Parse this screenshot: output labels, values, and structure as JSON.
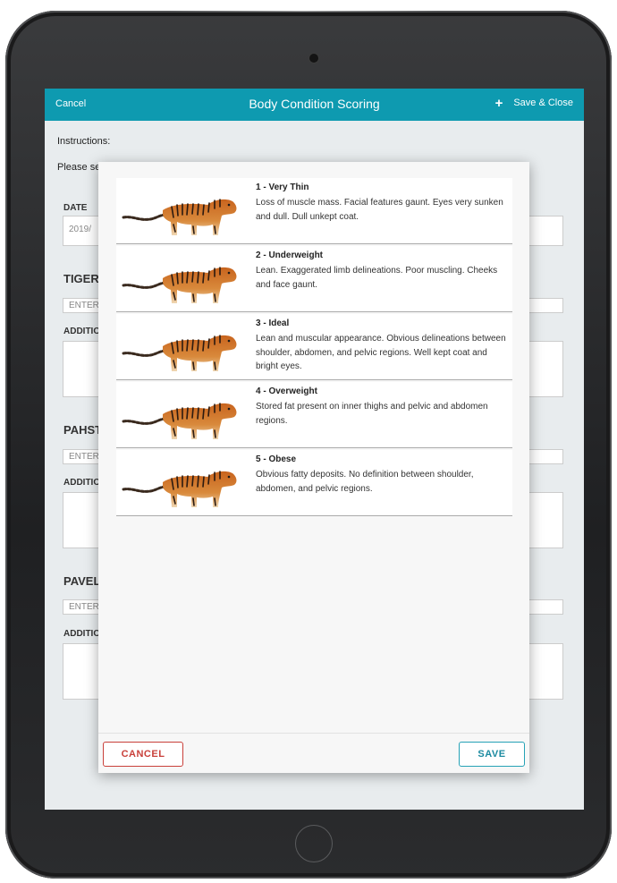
{
  "header": {
    "cancel_label": "Cancel",
    "title": "Body Condition Scoring",
    "plus_icon": "+",
    "save_close_label": "Save & Close"
  },
  "form": {
    "instructions_label": "Instructions:",
    "instructions_text": "Please se",
    "date_label": "DATE",
    "date_value": "2019/",
    "sections": [
      {
        "title": "TIGER",
        "input_placeholder": "ENTER",
        "additional_label": "ADDITIO"
      },
      {
        "title": "PAHST",
        "input_placeholder": "ENTER",
        "additional_label": "ADDITIO"
      },
      {
        "title": "PAVEL",
        "input_placeholder": "ENTER",
        "additional_label": "ADDITIO"
      }
    ]
  },
  "modal": {
    "options": [
      {
        "title": "1 - Very Thin",
        "description": "Loss of muscle mass. Facial features gaunt. Eyes very sunken and dull. Dull unkept coat.",
        "image": "tiger-very-thin"
      },
      {
        "title": "2 - Underweight",
        "description": "Lean. Exaggerated limb delineations. Poor muscling. Cheeks and face gaunt.",
        "image": "tiger-underweight"
      },
      {
        "title": "3 - Ideal",
        "description": "Lean and muscular appearance. Obvious delineations between shoulder, abdomen, and pelvic regions. Well kept coat and bright eyes.",
        "image": "tiger-ideal"
      },
      {
        "title": "4 - Overweight",
        "description": "Stored fat present on inner thighs and pelvic and abdomen regions.",
        "image": "tiger-overweight"
      },
      {
        "title": "5 - Obese",
        "description": "Obvious fatty deposits. No definition between shoulder, abdomen, and pelvic regions.",
        "image": "tiger-obese"
      }
    ],
    "cancel_label": "CANCEL",
    "save_label": "SAVE"
  },
  "colors": {
    "header": "#0e9ab0",
    "cancel_button": "#c9403a",
    "save_button": "#26a2b6"
  }
}
